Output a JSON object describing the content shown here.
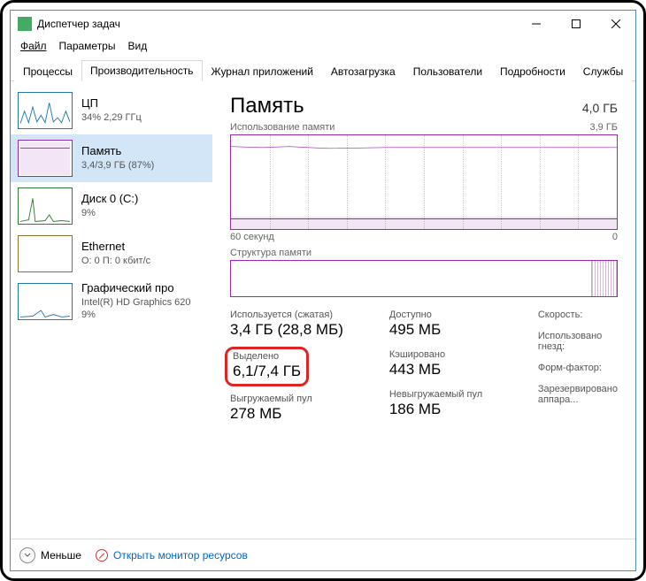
{
  "window": {
    "title": "Диспетчер задач"
  },
  "menu": {
    "file": "Файл",
    "options": "Параметры",
    "view": "Вид"
  },
  "tabs": {
    "processes": "Процессы",
    "performance": "Производительность",
    "apphistory": "Журнал приложений",
    "startup": "Автозагрузка",
    "users": "Пользователи",
    "details": "Подробности",
    "services": "Службы"
  },
  "sidebar": {
    "cpu": {
      "title": "ЦП",
      "sub": "34% 2,29 ГГц"
    },
    "memory": {
      "title": "Память",
      "sub": "3,4/3,9 ГБ (87%)"
    },
    "disk": {
      "title": "Диск 0 (C:)",
      "sub": "9%"
    },
    "ethernet": {
      "title": "Ethernet",
      "sub": "О: 0 П: 0 кбит/с"
    },
    "gpu": {
      "title": "Графический про",
      "sub": "Intel(R) HD Graphics 620",
      "third": "9%"
    }
  },
  "main": {
    "heading": "Память",
    "total": "4,0 ГБ",
    "usage_label": "Использование памяти",
    "usage_max": "3,9 ГБ",
    "xaxis_left": "60 секунд",
    "xaxis_right": "0",
    "struct_label": "Структура памяти"
  },
  "stats": {
    "inuse": {
      "label": "Используется (сжатая)",
      "value": "3,4 ГБ (28,8 МБ)"
    },
    "avail": {
      "label": "Доступно",
      "value": "495 МБ"
    },
    "commit": {
      "label": "Выделено",
      "value": "6,1/7,4 ГБ"
    },
    "cached": {
      "label": "Кэшировано",
      "value": "443 МБ"
    },
    "paged": {
      "label": "Выгружаемый пул",
      "value": "278 МБ"
    },
    "nonpaged": {
      "label": "Невыгружаемый пул",
      "value": "186 МБ"
    },
    "speed": {
      "label": "Скорость:",
      "value": ""
    },
    "slots": {
      "label": "Использовано гнезд:",
      "value": ""
    },
    "form": {
      "label": "Форм-фактор:",
      "value": ""
    },
    "reserved": {
      "label": "Зарезервировано аппара...",
      "value": ""
    }
  },
  "footer": {
    "less": "Меньше",
    "monitor_link": "Открыть монитор ресурсов"
  }
}
